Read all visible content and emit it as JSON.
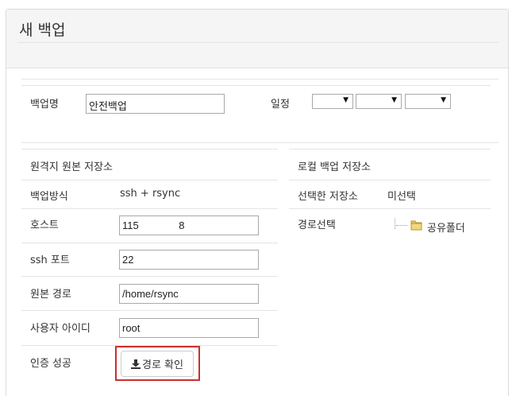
{
  "panel": {
    "title": "새 백업"
  },
  "backup": {
    "name_label": "백업명",
    "name_value": "안전백업",
    "schedule_label": "일정",
    "schedule_selects": [
      "",
      "",
      ""
    ]
  },
  "remote": {
    "section_title": "원격지 원본 저장소",
    "method_label": "백업방식",
    "method_value": "ssh + rsync",
    "host_label": "호스트",
    "host_value": "115              8",
    "port_label": "ssh 포트",
    "port_value": "22",
    "path_label": "원본 경로",
    "path_value": "/home/rsync",
    "user_label": "사용자 아이디",
    "user_value": "root",
    "auth_label": "인증 성공",
    "check_button_label": "경로 확인"
  },
  "local": {
    "section_title": "로컬 백업 저장소",
    "selected_label": "선택한 저장소",
    "selected_value": "미선택",
    "path_select_label": "경로선택",
    "tree_folder_label": "공유폴더"
  },
  "icons": {
    "download": "download-icon",
    "folder": "folder-icon",
    "dropdown": "caret-down-icon"
  },
  "colors": {
    "highlight": "#c9302c",
    "folder": "#e7c664"
  }
}
